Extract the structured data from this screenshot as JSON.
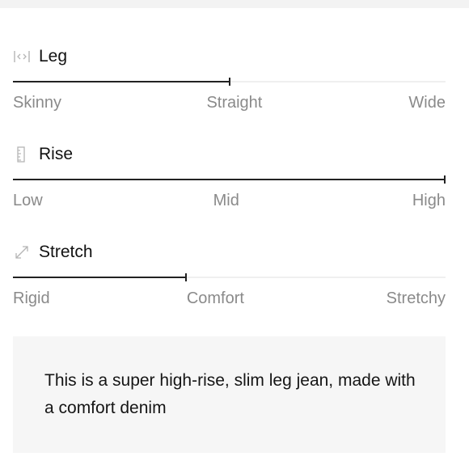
{
  "fit": {
    "attributes": [
      {
        "key": "leg",
        "icon": "leg-width-icon",
        "title": "Leg",
        "value_fraction": 0.5,
        "labels": [
          "Skinny",
          "Straight",
          "Wide"
        ]
      },
      {
        "key": "rise",
        "icon": "ruler-icon",
        "title": "Rise",
        "value_fraction": 1.0,
        "labels": [
          "Low",
          "Mid",
          "High"
        ]
      },
      {
        "key": "stretch",
        "icon": "expand-arrows-icon",
        "title": "Stretch",
        "value_fraction": 0.4,
        "labels": [
          "Rigid",
          "Comfort",
          "Stretchy"
        ]
      }
    ],
    "description": "This is a super high-rise, slim leg jean, made with a comfort denim"
  }
}
